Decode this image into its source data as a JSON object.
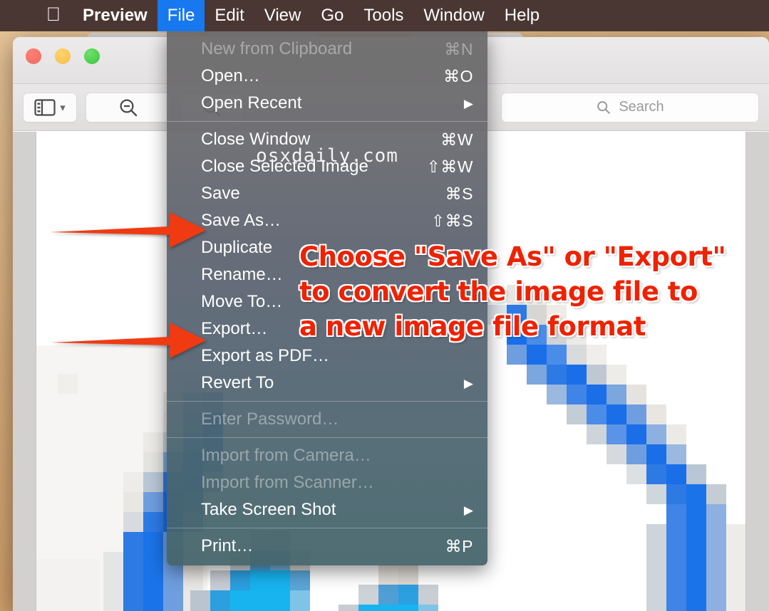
{
  "menubar": {
    "apple_icon": "apple-logo",
    "items": [
      {
        "label": "Preview",
        "bold": true,
        "active": false
      },
      {
        "label": "File",
        "bold": false,
        "active": true
      },
      {
        "label": "Edit",
        "bold": false,
        "active": false
      },
      {
        "label": "View",
        "bold": false,
        "active": false
      },
      {
        "label": "Go",
        "bold": false,
        "active": false
      },
      {
        "label": "Tools",
        "bold": false,
        "active": false
      },
      {
        "label": "Window",
        "bold": false,
        "active": false
      },
      {
        "label": "Help",
        "bold": false,
        "active": false
      }
    ]
  },
  "window": {
    "traffic_lights": [
      "close",
      "minimize",
      "zoom"
    ],
    "toolbar": {
      "sidebar_icon": "sidebar-icon",
      "sidebar_chevron": "chevron-down-icon",
      "zoom_out_icon": "zoom-out-icon",
      "zoom_in_icon": "zoom-in-icon",
      "markup_chevron": "chevron-down-icon",
      "search_icon": "search-icon",
      "search_placeholder": "Search",
      "search_value": ""
    }
  },
  "file_menu": {
    "title": "File",
    "items": [
      {
        "type": "item",
        "label": "New from Clipboard",
        "shortcut": "⌘N",
        "disabled": true,
        "submenu": false
      },
      {
        "type": "item",
        "label": "Open…",
        "shortcut": "⌘O",
        "disabled": false,
        "submenu": false
      },
      {
        "type": "item",
        "label": "Open Recent",
        "shortcut": "",
        "disabled": false,
        "submenu": true
      },
      {
        "type": "separator"
      },
      {
        "type": "item",
        "label": "Close Window",
        "shortcut": "⌘W",
        "disabled": false,
        "submenu": false
      },
      {
        "type": "item",
        "label": "Close Selected Image",
        "shortcut": "⇧⌘W",
        "disabled": false,
        "submenu": false
      },
      {
        "type": "item",
        "label": "Save",
        "shortcut": "⌘S",
        "disabled": false,
        "submenu": false
      },
      {
        "type": "item",
        "label": "Save As…",
        "shortcut": "⇧⌘S",
        "disabled": false,
        "submenu": false
      },
      {
        "type": "item",
        "label": "Duplicate",
        "shortcut": "",
        "disabled": false,
        "submenu": false
      },
      {
        "type": "item",
        "label": "Rename…",
        "shortcut": "",
        "disabled": false,
        "submenu": false
      },
      {
        "type": "item",
        "label": "Move To…",
        "shortcut": "",
        "disabled": false,
        "submenu": false
      },
      {
        "type": "item",
        "label": "Export…",
        "shortcut": "",
        "disabled": false,
        "submenu": false
      },
      {
        "type": "item",
        "label": "Export as PDF…",
        "shortcut": "",
        "disabled": false,
        "submenu": false
      },
      {
        "type": "item",
        "label": "Revert To",
        "shortcut": "",
        "disabled": false,
        "submenu": true
      },
      {
        "type": "separator"
      },
      {
        "type": "item",
        "label": "Enter Password…",
        "shortcut": "",
        "disabled": true,
        "submenu": false
      },
      {
        "type": "separator"
      },
      {
        "type": "item",
        "label": "Import from Camera…",
        "shortcut": "",
        "disabled": true,
        "submenu": false
      },
      {
        "type": "item",
        "label": "Import from Scanner…",
        "shortcut": "",
        "disabled": true,
        "submenu": false
      },
      {
        "type": "item",
        "label": "Take Screen Shot",
        "shortcut": "",
        "disabled": false,
        "submenu": true
      },
      {
        "type": "separator"
      },
      {
        "type": "item",
        "label": "Print…",
        "shortcut": "⌘P",
        "disabled": false,
        "submenu": false
      }
    ]
  },
  "watermark": {
    "text": "osxdaily.com"
  },
  "annotation": {
    "color": "#ee2200",
    "lines": [
      "Choose \"Save As\" or \"Export\"",
      "to convert the image file to",
      "a new image file format"
    ]
  },
  "arrows": [
    {
      "name": "arrow-to-save-as",
      "points_to": "Save As…"
    },
    {
      "name": "arrow-to-export",
      "points_to": "Export…"
    }
  ],
  "colors": {
    "menubar_bg": "#4a3733",
    "menu_highlight": "#1878f0",
    "arrow_red": "#f03a12",
    "annotation_red": "#ee2200",
    "swirl_blue": "#1a73e8",
    "swirl_cyan": "#18b4f0"
  }
}
